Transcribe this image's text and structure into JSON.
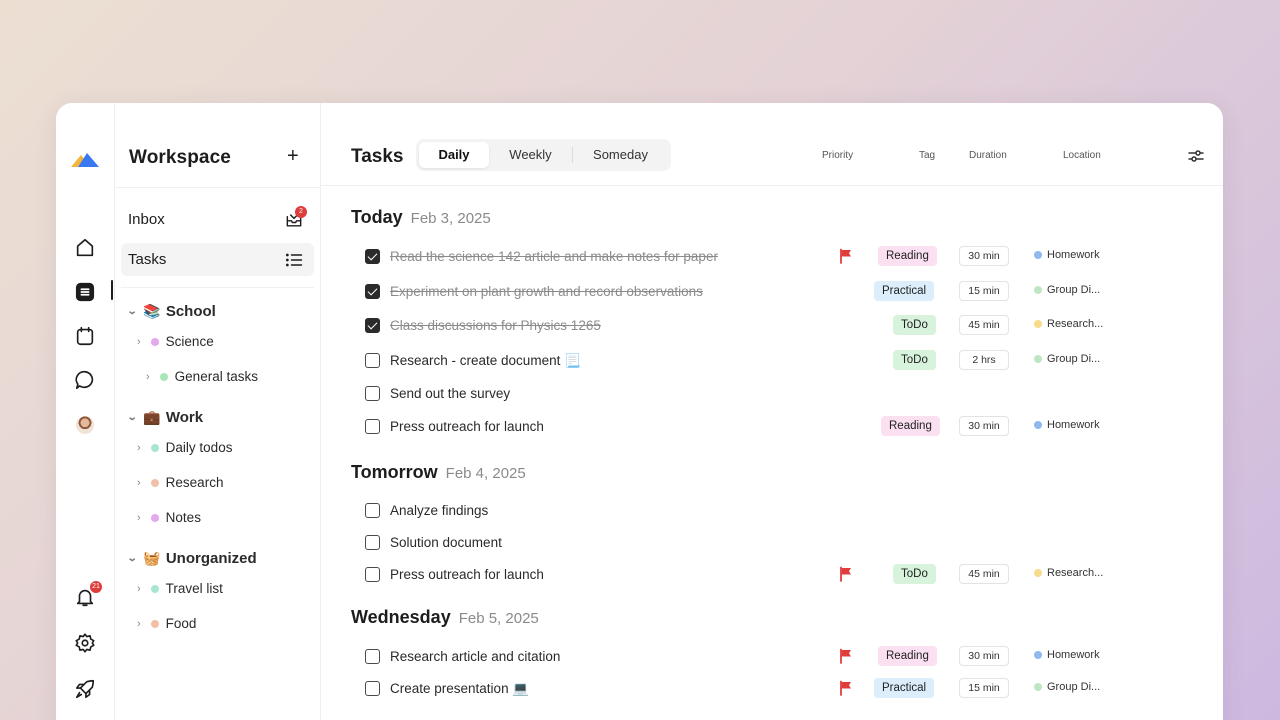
{
  "colors": {
    "flag": "#e03c3c",
    "reading": "#fbe0f1",
    "practical": "#dceefc",
    "todo": "#d8f3dc",
    "homework_dot": "#8fb8ee",
    "group_dot": "#bfe6c2",
    "research_dot": "#f7dc8c"
  },
  "rail": {
    "notifications_badge": "21",
    "icons": [
      "logo-icon",
      "home-icon",
      "tasks-icon",
      "calendar-icon",
      "chat-icon",
      "avatar",
      "bell-icon",
      "settings-icon",
      "rocket-icon"
    ]
  },
  "sidebar": {
    "title": "Workspace",
    "add": "+",
    "inbox": {
      "label": "Inbox",
      "badge": "2"
    },
    "tasks": {
      "label": "Tasks"
    },
    "groups": [
      {
        "emoji": "📚",
        "name": "School",
        "items": [
          {
            "label": "Science",
            "dot": "#e3a8ee"
          },
          {
            "label": "General tasks",
            "dot": "#a8e6b8"
          }
        ]
      },
      {
        "emoji": "💼",
        "name": "Work",
        "items": [
          {
            "label": "Daily todos",
            "dot": "#a8e6cf"
          },
          {
            "label": "Research",
            "dot": "#f0c0a8"
          },
          {
            "label": "Notes",
            "dot": "#e3a8ee"
          }
        ]
      },
      {
        "emoji": "🧺",
        "name": "Unorganized",
        "items": [
          {
            "label": "Travel list",
            "dot": "#a8e6cf"
          },
          {
            "label": "Food",
            "dot": "#f0c0a8"
          }
        ]
      }
    ]
  },
  "main": {
    "title": "Tasks",
    "tabs": [
      "Daily",
      "Weekly",
      "Someday"
    ],
    "active_tab": "Daily",
    "columns": {
      "priority": "Priority",
      "tag": "Tag",
      "duration": "Duration",
      "location": "Location"
    }
  },
  "sections": [
    {
      "day": "Today",
      "date": "Feb 3, 2025",
      "tasks": [
        {
          "text": "Read the science 142 article and make notes for paper",
          "done": true,
          "flag": true,
          "tag": "Reading",
          "tag_type": "reading",
          "duration": "30 min",
          "location": "Homework",
          "loc_color": "#8fb8ee"
        },
        {
          "text": "Experiment on plant growth and record observations",
          "done": true,
          "flag": false,
          "tag": "Practical",
          "tag_type": "practical",
          "duration": "15 min",
          "location": "Group Di...",
          "loc_color": "#bfe6c2"
        },
        {
          "text": "Class discussions for Physics 1265",
          "done": true,
          "flag": false,
          "tag": "ToDo",
          "tag_type": "todo",
          "duration": "45 min",
          "location": "Research...",
          "loc_color": "#f7dc8c"
        },
        {
          "text": "Research - create document 📃",
          "done": false,
          "flag": false,
          "tag": "ToDo",
          "tag_type": "todo",
          "duration": "2 hrs",
          "location": "Group Di...",
          "loc_color": "#bfe6c2"
        },
        {
          "text": "Send out the survey",
          "done": false,
          "flag": false
        },
        {
          "text": "Press outreach for launch",
          "done": false,
          "flag": false,
          "tag": "Reading",
          "tag_type": "reading",
          "duration": "30 min",
          "location": "Homework",
          "loc_color": "#8fb8ee"
        }
      ]
    },
    {
      "day": "Tomorrow",
      "date": "Feb 4, 2025",
      "tasks": [
        {
          "text": "Analyze findings",
          "done": false,
          "flag": false
        },
        {
          "text": "Solution document",
          "done": false,
          "flag": false
        },
        {
          "text": "Press outreach for launch",
          "done": false,
          "flag": true,
          "tag": "ToDo",
          "tag_type": "todo",
          "duration": "45 min",
          "location": "Research...",
          "loc_color": "#f7dc8c"
        }
      ]
    },
    {
      "day": "Wednesday",
      "date": "Feb 5, 2025",
      "tasks": [
        {
          "text": "Research article and citation",
          "done": false,
          "flag": true,
          "tag": "Reading",
          "tag_type": "reading",
          "duration": "30 min",
          "location": "Homework",
          "loc_color": "#8fb8ee"
        },
        {
          "text": "Create presentation 💻",
          "done": false,
          "flag": true,
          "tag": "Practical",
          "tag_type": "practical",
          "duration": "15 min",
          "location": "Group Di...",
          "loc_color": "#bfe6c2"
        }
      ]
    }
  ]
}
